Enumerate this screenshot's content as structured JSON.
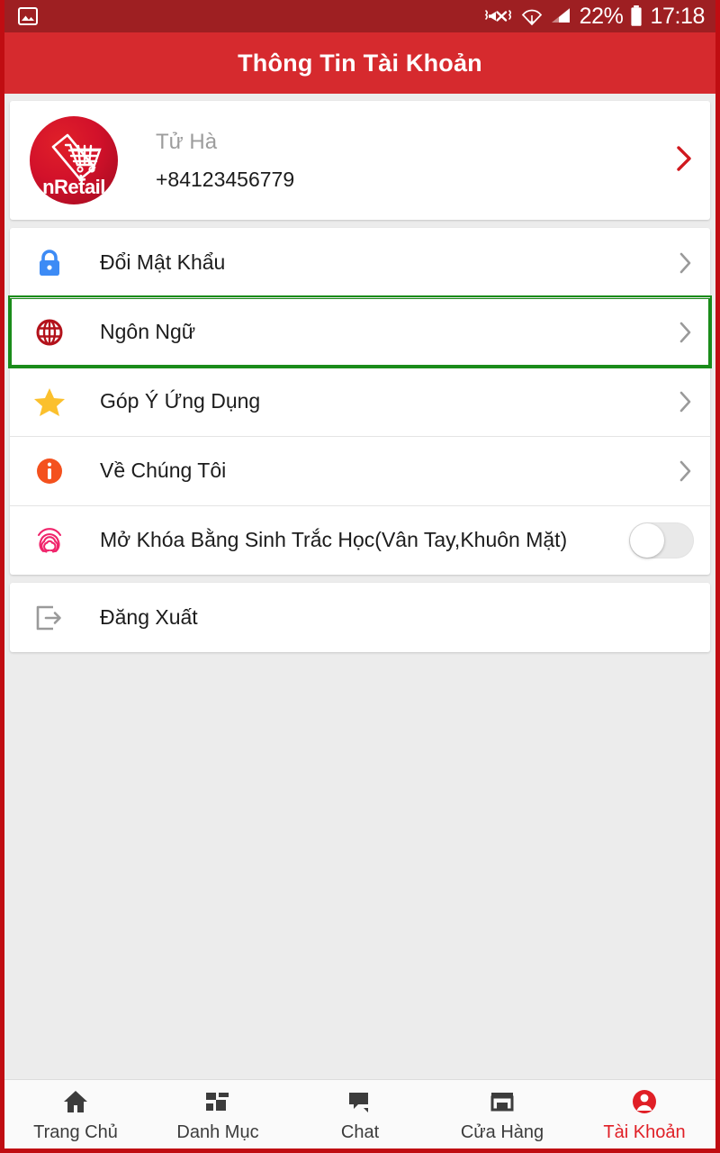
{
  "statusbar": {
    "battery_percent": "22%",
    "time": "17:18",
    "icons": [
      "image-icon",
      "mute-vibrate-icon",
      "wifi-icon",
      "signal-icon",
      "battery-icon"
    ]
  },
  "appbar": {
    "title": "Thông Tin Tài Khoản"
  },
  "profile": {
    "brand": "nRetail",
    "name": "Tử Hà",
    "phone": "+84123456779",
    "chevron": "chevron-right-icon",
    "chevron_color": "#d0191f"
  },
  "menu": [
    {
      "key": "change-password",
      "label": "Đổi Mật Khẩu",
      "icon": "lock-icon",
      "icon_color": "#3d8bf5",
      "trailing": "chevron-right-icon",
      "highlighted": false
    },
    {
      "key": "language",
      "label": "Ngôn Ngữ",
      "icon": "globe-icon",
      "icon_color": "#b3121b",
      "trailing": "chevron-right-icon",
      "highlighted": true
    },
    {
      "key": "feedback",
      "label": "Góp Ý Ứng Dụng",
      "icon": "star-icon",
      "icon_color": "#fbc02d",
      "trailing": "chevron-right-icon",
      "highlighted": false
    },
    {
      "key": "about-us",
      "label": "Về Chúng Tôi",
      "icon": "info-icon",
      "icon_color": "#f4511e",
      "trailing": "chevron-right-icon",
      "highlighted": false
    },
    {
      "key": "biometric-unlock",
      "label": "Mở Khóa Bằng Sinh Trắc Học(Vân Tay,Khuôn Mặt)",
      "icon": "fingerprint-icon",
      "icon_color": "#f0246b",
      "trailing": "toggle-switch",
      "toggle_on": false,
      "highlighted": false
    }
  ],
  "logout": {
    "label": "Đăng Xuất",
    "icon": "logout-icon",
    "icon_color": "#9a9a9a"
  },
  "bottomnav": {
    "items": [
      {
        "key": "home",
        "label": "Trang Chủ",
        "icon": "home-icon",
        "active": false
      },
      {
        "key": "category",
        "label": "Danh Mục",
        "icon": "dashboard-icon",
        "active": false
      },
      {
        "key": "chat",
        "label": "Chat",
        "icon": "chat-icon",
        "active": false
      },
      {
        "key": "store",
        "label": "Cửa Hàng",
        "icon": "store-icon",
        "active": false
      },
      {
        "key": "account",
        "label": "Tài Khoản",
        "icon": "account-icon",
        "active": true
      }
    ]
  },
  "theme": {
    "statusbar_bg": "#9e1f22",
    "appbar_bg": "#d62a2e",
    "page_bg": "#ececec",
    "accent": "#e01f26",
    "highlight_border": "#1a8c1a",
    "frame_border": "#c00d12"
  }
}
